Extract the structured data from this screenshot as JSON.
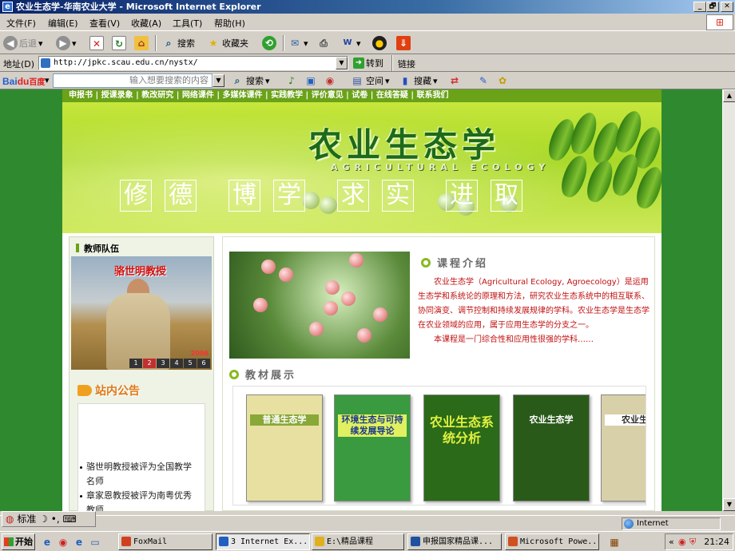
{
  "window": {
    "title": "农业生态学-华南农业大学 - Microsoft Internet Explorer",
    "controls": [
      "_",
      "🗗",
      "✕"
    ]
  },
  "menubar": {
    "items": [
      "文件(F)",
      "编辑(E)",
      "查看(V)",
      "收藏(A)",
      "工具(T)",
      "帮助(H)"
    ]
  },
  "toolbar": {
    "back": "后退",
    "search": "搜索",
    "favorites": "收藏夹"
  },
  "address": {
    "label": "地址(D)",
    "url": "http://jpkc.scau.edu.cn/nystx/",
    "go": "转到",
    "links": "链接"
  },
  "baidu": {
    "logo_a": "Bai",
    "logo_b": "du",
    "logo_c": "百度",
    "placeholder": "输入想要搜索的内容",
    "search": "搜索",
    "space": "空间",
    "collect": "搜藏"
  },
  "site": {
    "nav": "申报书 | 授课录象 | 教改研究 | 网络课件 | 多媒体课件 | 实践教学 | 评价意见 | 试卷 | 在线答疑 | 联系我们",
    "title": "农业生态学",
    "subtitle": "AGRICULTURAL ECOLOGY",
    "motto": [
      "修",
      "德",
      "博",
      "学",
      "求",
      "实",
      "进",
      "取"
    ],
    "teacher_heading": "教师队伍",
    "teacher_name": "骆世明教授",
    "photo_year": "2006",
    "photo_pages": [
      "1",
      "2",
      "3",
      "4",
      "5",
      "6"
    ],
    "notice_heading": "站内公告",
    "notices": [
      "骆世明教授被评为全国教学名师",
      "章家恩教授被评为南粤优秀教师"
    ],
    "intro_heading": "课程介绍",
    "intro_p1": "农业生态学（Agricultural Ecology, Agroecology）是运用生态学和系统论的原理和方法，研究农业生态系统中的相互联系、协同演变、调节控制和持续发展规律的学科。农业生态学是生态学在农业领域的应用，属于应用生态学的分支之一。",
    "intro_p2": "本课程是一门综合性和应用性很强的学科……",
    "books_heading": "教材展示",
    "books": [
      {
        "title": "普通生态学",
        "bg": "#e8e0a0",
        "fg": "#ffffff"
      },
      {
        "title": "环境生态与可持续发展导论",
        "bg": "#3a9a40",
        "fg": "#1a3a8a"
      },
      {
        "title": "农业生态系统分析",
        "bg": "#2a6a18",
        "fg": "#e0f040"
      },
      {
        "title": "农业生态学",
        "bg": "#2a5a1a",
        "fg": "#ffffff"
      },
      {
        "title": "农业生态",
        "bg": "#d8d0a8",
        "fg": "#303030"
      }
    ]
  },
  "langbar": {
    "label": "标准"
  },
  "statusbar": {
    "zone": "Internet"
  },
  "taskbar": {
    "start": "开始",
    "tasks": [
      {
        "label": "FoxMail",
        "color": "#d04020"
      },
      {
        "label": "3 Internet Ex...",
        "color": "#2060c0"
      },
      {
        "label": "E:\\精品课程",
        "color": "#e0b020"
      },
      {
        "label": "申报国家精品课...",
        "color": "#2050a0"
      },
      {
        "label": "Microsoft Powe...",
        "color": "#d05020"
      }
    ],
    "clock": "21:24"
  }
}
